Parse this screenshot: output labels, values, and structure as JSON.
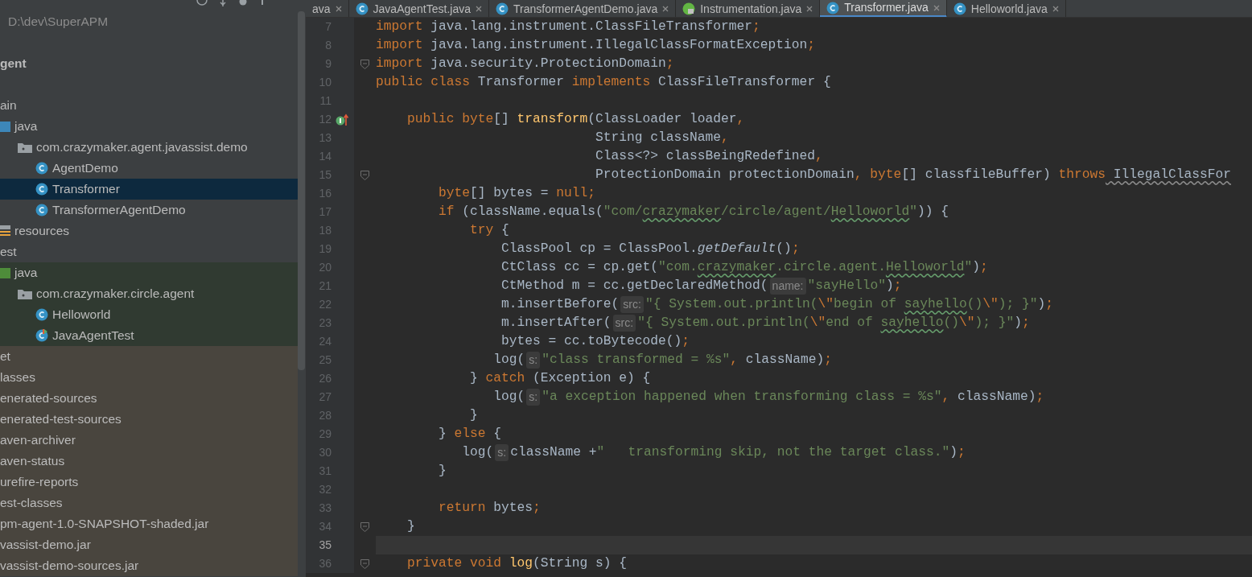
{
  "sidebar": {
    "tree": [
      {
        "label": "D:\\dev\\SuperAPM",
        "kind": "path",
        "selected": false,
        "test": false,
        "excluded": false
      },
      {
        "kind": "gap"
      },
      {
        "label": "gent",
        "kind": "module",
        "selected": false,
        "test": false,
        "excluded": false
      },
      {
        "kind": "gap"
      },
      {
        "label": "ain",
        "kind": "folder",
        "selected": false,
        "test": false,
        "excluded": false,
        "children": [
          {
            "label": "java",
            "kind": "source-root",
            "selected": false,
            "test": false,
            "excluded": false,
            "children": [
              {
                "label": "com.crazymaker.agent.javassist.demo",
                "kind": "package",
                "selected": false,
                "test": false,
                "excluded": false,
                "children": [
                  {
                    "label": "AgentDemo",
                    "kind": "class",
                    "selected": false,
                    "test": false,
                    "excluded": false
                  },
                  {
                    "label": "Transformer",
                    "kind": "class",
                    "selected": true
                  },
                  {
                    "label": "TransformerAgentDemo",
                    "kind": "class",
                    "selected": false,
                    "test": false,
                    "excluded": false
                  }
                ]
              }
            ]
          },
          {
            "label": "resources",
            "kind": "resources",
            "selected": false,
            "test": false,
            "excluded": false
          }
        ]
      },
      {
        "label": "est",
        "kind": "folder",
        "selected": false,
        "test": false,
        "excluded": false,
        "children": [
          {
            "label": "java",
            "kind": "test-root",
            "selected": false,
            "test": true,
            "excluded": false,
            "children": [
              {
                "label": "com.crazymaker.circle.agent",
                "kind": "package",
                "selected": false,
                "test": true,
                "excluded": false,
                "children": [
                  {
                    "label": "Helloworld",
                    "kind": "class",
                    "selected": false,
                    "test": true,
                    "excluded": false
                  },
                  {
                    "label": "JavaAgentTest",
                    "kind": "runnable-class",
                    "selected": false,
                    "test": true,
                    "excluded": false
                  }
                ]
              }
            ]
          }
        ]
      },
      {
        "label": "et",
        "kind": "folder",
        "selected": false,
        "excluded": true
      },
      {
        "label": "lasses",
        "kind": "folder",
        "selected": false,
        "excluded": true
      },
      {
        "label": "enerated-sources",
        "kind": "folder",
        "selected": false,
        "excluded": true
      },
      {
        "label": "enerated-test-sources",
        "kind": "folder",
        "selected": false,
        "excluded": true
      },
      {
        "label": "aven-archiver",
        "kind": "folder",
        "selected": false,
        "excluded": true
      },
      {
        "label": "aven-status",
        "kind": "folder",
        "selected": false,
        "excluded": true
      },
      {
        "label": "urefire-reports",
        "kind": "folder",
        "selected": false,
        "excluded": true
      },
      {
        "label": "est-classes",
        "kind": "folder",
        "selected": false,
        "excluded": true
      },
      {
        "label": "pm-agent-1.0-SNAPSHOT-shaded.jar",
        "kind": "folder",
        "selected": false,
        "excluded": true
      },
      {
        "label": "vassist-demo.jar",
        "kind": "folder",
        "selected": false,
        "excluded": true
      },
      {
        "label": "vassist-demo-sources.jar",
        "kind": "folder",
        "selected": false,
        "excluded": true
      }
    ]
  },
  "editor": {
    "tabs": [
      {
        "label": "ava",
        "kind": "plain",
        "selected": false
      },
      {
        "label": "JavaAgentTest.java",
        "kind": "class",
        "selected": false
      },
      {
        "label": "TransformerAgentDemo.java",
        "kind": "class",
        "selected": false
      },
      {
        "label": "Instrumentation.java",
        "kind": "locked",
        "selected": false
      },
      {
        "label": "Transformer.java",
        "kind": "class",
        "selected": true
      },
      {
        "label": "Helloworld.java",
        "kind": "class",
        "selected": false
      }
    ],
    "lines": [
      {
        "number": "7",
        "kind": "plain",
        "current": false,
        "segments": [
          {
            "kind": "keyword",
            "text": "import"
          },
          {
            "kind": "plain",
            "text": " java.lang.instrument.ClassFileTransformer"
          },
          {
            "kind": "keyword",
            "text": ";"
          }
        ]
      },
      {
        "number": "8",
        "kind": "plain",
        "current": false,
        "segments": [
          {
            "kind": "keyword",
            "text": "import"
          },
          {
            "kind": "plain",
            "text": " java.lang.instrument.IllegalClassFormatException"
          },
          {
            "kind": "keyword",
            "text": ";"
          }
        ]
      },
      {
        "number": "9",
        "kind": "fold",
        "current": false,
        "segments": [
          {
            "kind": "keyword",
            "text": "import"
          },
          {
            "kind": "plain",
            "text": " java.security.ProtectionDomain"
          },
          {
            "kind": "keyword",
            "text": ";"
          }
        ]
      },
      {
        "number": "10",
        "kind": "plain",
        "current": false,
        "segments": [
          {
            "kind": "keyword",
            "text": "public class"
          },
          {
            "kind": "plain",
            "text": " Transformer "
          },
          {
            "kind": "keyword",
            "text": "implements"
          },
          {
            "kind": "plain",
            "text": " ClassFileTransformer {"
          }
        ]
      },
      {
        "number": "11",
        "kind": "plain",
        "current": false
      },
      {
        "number": "12",
        "kind": "implements",
        "current": false,
        "segments": [
          {
            "kind": "keyword",
            "text": "    public byte"
          },
          {
            "kind": "plain",
            "text": "[] "
          },
          {
            "kind": "method",
            "text": "transform"
          },
          {
            "kind": "plain",
            "text": "(ClassLoader loader"
          },
          {
            "kind": "keyword",
            "text": ","
          }
        ]
      },
      {
        "number": "13",
        "kind": "plain",
        "current": false,
        "segments": [
          {
            "kind": "plain",
            "text": "                            String className"
          },
          {
            "kind": "keyword",
            "text": ","
          }
        ]
      },
      {
        "number": "14",
        "kind": "plain",
        "current": false,
        "segments": [
          {
            "kind": "plain",
            "text": "                            Class<?> classBeingRedefined"
          },
          {
            "kind": "keyword",
            "text": ","
          }
        ]
      },
      {
        "number": "15",
        "kind": "fold",
        "current": false,
        "segments": [
          {
            "kind": "plain",
            "text": "                            ProtectionDomain protectionDomain"
          },
          {
            "kind": "keyword",
            "text": ", byte"
          },
          {
            "kind": "plain",
            "text": "[] classfileBuffer) "
          },
          {
            "kind": "keyword",
            "text": "throws"
          },
          {
            "kind": "warning",
            "text": " IllegalClassFor"
          }
        ]
      },
      {
        "number": "16",
        "kind": "plain",
        "current": false,
        "segments": [
          {
            "kind": "keyword",
            "text": "        byte"
          },
          {
            "kind": "plain",
            "text": "[] bytes = "
          },
          {
            "kind": "keyword",
            "text": "null;"
          }
        ]
      },
      {
        "number": "17",
        "kind": "plain",
        "current": false,
        "segments": [
          {
            "kind": "keyword",
            "text": "        if"
          },
          {
            "kind": "plain",
            "text": " (className.equals("
          },
          {
            "kind": "string",
            "text": "\"com/"
          },
          {
            "kind": "typo",
            "text": "crazymaker"
          },
          {
            "kind": "string",
            "text": "/circle/agent/"
          },
          {
            "kind": "typo",
            "text": "Helloworld"
          },
          {
            "kind": "string",
            "text": "\""
          },
          {
            "kind": "plain",
            "text": ")) {"
          }
        ]
      },
      {
        "number": "18",
        "kind": "plain",
        "current": false,
        "segments": [
          {
            "kind": "keyword",
            "text": "            try"
          },
          {
            "kind": "plain",
            "text": " {"
          }
        ]
      },
      {
        "number": "19",
        "kind": "plain",
        "current": false,
        "segments": [
          {
            "kind": "plain",
            "text": "                ClassPool cp = ClassPool."
          },
          {
            "kind": "italic",
            "text": "getDefault"
          },
          {
            "kind": "plain",
            "text": "()"
          },
          {
            "kind": "keyword",
            "text": ";"
          }
        ]
      },
      {
        "number": "20",
        "kind": "plain",
        "current": false,
        "segments": [
          {
            "kind": "plain",
            "text": "                CtClass cc = cp.get("
          },
          {
            "kind": "string",
            "text": "\"com."
          },
          {
            "kind": "typo",
            "text": "crazymaker"
          },
          {
            "kind": "string",
            "text": ".circle.agent."
          },
          {
            "kind": "typo",
            "text": "Helloworld"
          },
          {
            "kind": "string",
            "text": "\""
          },
          {
            "kind": "plain",
            "text": ")"
          },
          {
            "kind": "keyword",
            "text": ";"
          }
        ]
      },
      {
        "number": "21",
        "kind": "plain",
        "current": false,
        "segments": [
          {
            "kind": "plain",
            "text": "                CtMethod m = cc.getDeclaredMethod("
          },
          {
            "kind": "hint",
            "text": "name:"
          },
          {
            "kind": "string",
            "text": "\"sayHello\""
          },
          {
            "kind": "plain",
            "text": ")"
          },
          {
            "kind": "keyword",
            "text": ";"
          }
        ]
      },
      {
        "number": "22",
        "kind": "plain",
        "current": false,
        "segments": [
          {
            "kind": "plain",
            "text": "                m.insertBefore("
          },
          {
            "kind": "hint",
            "text": "src:"
          },
          {
            "kind": "string",
            "text": "\"{ System.out.println("
          },
          {
            "kind": "escape",
            "text": "\\\""
          },
          {
            "kind": "string",
            "text": "begin of "
          },
          {
            "kind": "typo",
            "text": "sayhello"
          },
          {
            "kind": "string",
            "text": "()"
          },
          {
            "kind": "escape",
            "text": "\\\""
          },
          {
            "kind": "string",
            "text": "); }\""
          },
          {
            "kind": "plain",
            "text": ")"
          },
          {
            "kind": "keyword",
            "text": ";"
          }
        ]
      },
      {
        "number": "23",
        "kind": "plain",
        "current": false,
        "segments": [
          {
            "kind": "plain",
            "text": "                m.insertAfter("
          },
          {
            "kind": "hint",
            "text": "src:"
          },
          {
            "kind": "string",
            "text": "\"{ System.out.println("
          },
          {
            "kind": "escape",
            "text": "\\\""
          },
          {
            "kind": "string",
            "text": "end of "
          },
          {
            "kind": "typo",
            "text": "sayhello"
          },
          {
            "kind": "string",
            "text": "()"
          },
          {
            "kind": "escape",
            "text": "\\\""
          },
          {
            "kind": "string",
            "text": "); }\""
          },
          {
            "kind": "plain",
            "text": ")"
          },
          {
            "kind": "keyword",
            "text": ";"
          }
        ]
      },
      {
        "number": "24",
        "kind": "plain",
        "current": false,
        "segments": [
          {
            "kind": "plain",
            "text": "                bytes = cc.toBytecode()"
          },
          {
            "kind": "keyword",
            "text": ";"
          }
        ]
      },
      {
        "number": "25",
        "kind": "plain",
        "current": false,
        "segments": [
          {
            "kind": "plain",
            "text": "               log("
          },
          {
            "kind": "hint",
            "text": "s:"
          },
          {
            "kind": "string",
            "text": "\"class transformed = %s\""
          },
          {
            "kind": "keyword",
            "text": ","
          },
          {
            "kind": "plain",
            "text": " className)"
          },
          {
            "kind": "keyword",
            "text": ";"
          }
        ]
      },
      {
        "number": "26",
        "kind": "plain",
        "current": false,
        "segments": [
          {
            "kind": "plain",
            "text": "            } "
          },
          {
            "kind": "keyword",
            "text": "catch"
          },
          {
            "kind": "plain",
            "text": " (Exception e) {"
          }
        ]
      },
      {
        "number": "27",
        "kind": "plain",
        "current": false,
        "segments": [
          {
            "kind": "plain",
            "text": "               log("
          },
          {
            "kind": "hint",
            "text": "s:"
          },
          {
            "kind": "string",
            "text": "\"a exception happened when transforming class = %s\""
          },
          {
            "kind": "keyword",
            "text": ","
          },
          {
            "kind": "plain",
            "text": " className)"
          },
          {
            "kind": "keyword",
            "text": ";"
          }
        ]
      },
      {
        "number": "28",
        "kind": "plain",
        "current": false,
        "segments": [
          {
            "kind": "plain",
            "text": "            }"
          }
        ]
      },
      {
        "number": "29",
        "kind": "plain",
        "current": false,
        "segments": [
          {
            "kind": "plain",
            "text": "        } "
          },
          {
            "kind": "keyword",
            "text": "else"
          },
          {
            "kind": "plain",
            "text": " {"
          }
        ]
      },
      {
        "number": "30",
        "kind": "plain",
        "current": false,
        "segments": [
          {
            "kind": "plain",
            "text": "           log("
          },
          {
            "kind": "hint",
            "text": "s:"
          },
          {
            "kind": "plain",
            "text": "className +"
          },
          {
            "kind": "string",
            "text": "\"   transforming skip, not the target class.\""
          },
          {
            "kind": "plain",
            "text": ")"
          },
          {
            "kind": "keyword",
            "text": ";"
          }
        ]
      },
      {
        "number": "31",
        "kind": "plain",
        "current": false,
        "segments": [
          {
            "kind": "plain",
            "text": "        }"
          }
        ]
      },
      {
        "number": "32",
        "kind": "plain",
        "current": false
      },
      {
        "number": "33",
        "kind": "plain",
        "current": false,
        "segments": [
          {
            "kind": "keyword",
            "text": "        return"
          },
          {
            "kind": "plain",
            "text": " bytes"
          },
          {
            "kind": "keyword",
            "text": ";"
          }
        ]
      },
      {
        "number": "34",
        "kind": "fold",
        "current": false,
        "segments": [
          {
            "kind": "plain",
            "text": "    }"
          }
        ]
      },
      {
        "number": "35",
        "kind": "plain",
        "current": true
      },
      {
        "number": "36",
        "kind": "fold",
        "current": false,
        "segments": [
          {
            "kind": "keyword",
            "text": "    private void "
          },
          {
            "kind": "method",
            "text": "log"
          },
          {
            "kind": "plain",
            "text": "(String s) {"
          }
        ]
      }
    ]
  }
}
